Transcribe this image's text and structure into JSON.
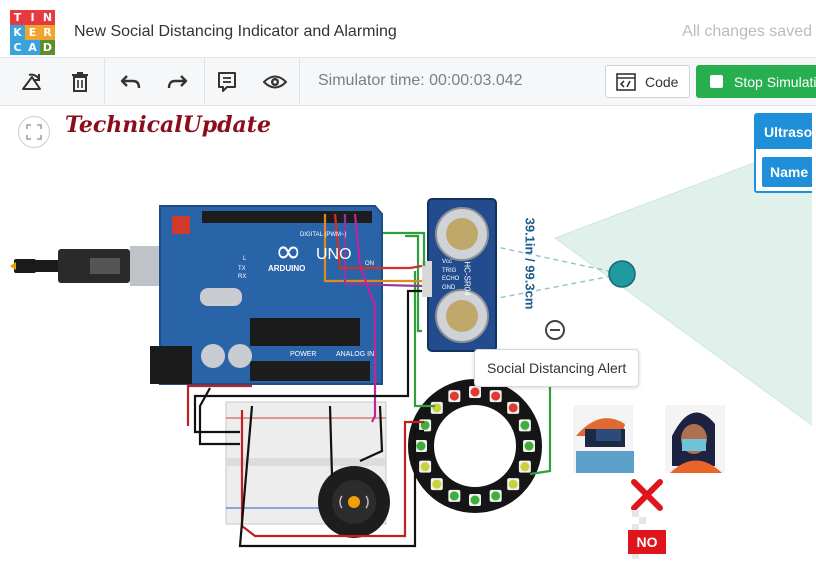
{
  "app": {
    "logo_letters": [
      "T",
      "I",
      "N",
      "K",
      "E",
      "R",
      "C",
      "A",
      "D"
    ],
    "title": "New Social Distancing Indicator and Alarming",
    "save_status": "All changes saved"
  },
  "toolbar": {
    "icons": [
      "rotate-icon",
      "trash-icon",
      "undo-icon",
      "redo-icon",
      "notes-icon",
      "eye-icon"
    ],
    "sim_time": "Simulator time: 00:00:03.042",
    "code_label": "Code",
    "stop_label": "Stop Simulation"
  },
  "canvas": {
    "watermark": "TechnicalUpdate",
    "ultrasonic_panel_title": "Ultrasonic",
    "ultrasonic_name_label": "Name",
    "distance_readout": "39.1in / 99.3cm",
    "tooltip": "Social Distancing Alert",
    "no_badge": "NO",
    "arduino": {
      "brand": "ARDUINO",
      "model": "UNO",
      "digital_label": "DIGITAL (PWM~)",
      "power_label": "POWER",
      "analog_label": "ANALOG IN",
      "on_label": "ON",
      "tx_label": "TX",
      "rx_label": "RX",
      "l_label": "L"
    },
    "sensor": {
      "model": "HC-SR04",
      "pins": [
        "Vcc",
        "TRIG",
        "ECHO",
        "GND"
      ]
    }
  },
  "colors": {
    "tinkercad_logo": [
      "#e53a40",
      "#e53a40",
      "#e53a40",
      "#3aa2de",
      "#f0a32f",
      "#f0a32f",
      "#3aa2de",
      "#3aa2de",
      "#5c8e2b"
    ],
    "accent_green": "#27ae4f",
    "accent_blue": "#1e8fd8",
    "arduino_blue": "#2a64a8"
  }
}
